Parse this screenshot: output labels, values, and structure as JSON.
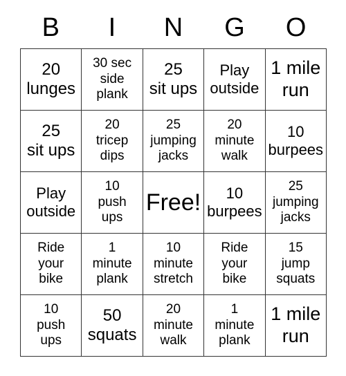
{
  "header": {
    "letters": [
      "B",
      "I",
      "N",
      "G",
      "O"
    ]
  },
  "colors": {
    "border": "#333333",
    "cell_background": "#ffffff",
    "text": "#000000",
    "page_background": "#ffffff"
  },
  "grid": {
    "rows": 5,
    "columns": 5,
    "cells": [
      {
        "text": "20\nlunges",
        "size": "fs-lg",
        "free": false
      },
      {
        "text": "30 sec\nside\nplank",
        "size": "fs-sm",
        "free": false
      },
      {
        "text": "25\nsit ups",
        "size": "fs-lg",
        "free": false
      },
      {
        "text": "Play\noutside",
        "size": "fs-md",
        "free": false
      },
      {
        "text": "1 mile\nrun",
        "size": "fs-xl",
        "free": false
      },
      {
        "text": "25\nsit ups",
        "size": "fs-lg",
        "free": false
      },
      {
        "text": "20\ntricep\ndips",
        "size": "fs-sm",
        "free": false
      },
      {
        "text": "25\njumping\njacks",
        "size": "fs-sm",
        "free": false
      },
      {
        "text": "20\nminute\nwalk",
        "size": "fs-sm",
        "free": false
      },
      {
        "text": "10\nburpees",
        "size": "fs-md",
        "free": false
      },
      {
        "text": "Play\noutside",
        "size": "fs-md",
        "free": false
      },
      {
        "text": "10\npush\nups",
        "size": "fs-sm",
        "free": false
      },
      {
        "text": "Free!",
        "size": "fs-free",
        "free": true
      },
      {
        "text": "10\nburpees",
        "size": "fs-md",
        "free": false
      },
      {
        "text": "25\njumping\njacks",
        "size": "fs-sm",
        "free": false
      },
      {
        "text": "Ride\nyour\nbike",
        "size": "fs-sm",
        "free": false
      },
      {
        "text": "1\nminute\nplank",
        "size": "fs-sm",
        "free": false
      },
      {
        "text": "10\nminute\nstretch",
        "size": "fs-sm",
        "free": false
      },
      {
        "text": "Ride\nyour\nbike",
        "size": "fs-sm",
        "free": false
      },
      {
        "text": "15\njump\nsquats",
        "size": "fs-sm",
        "free": false
      },
      {
        "text": "10\npush\nups",
        "size": "fs-sm",
        "free": false
      },
      {
        "text": "50\nsquats",
        "size": "fs-lg",
        "free": false
      },
      {
        "text": "20\nminute\nwalk",
        "size": "fs-sm",
        "free": false
      },
      {
        "text": "1\nminute\nplank",
        "size": "fs-sm",
        "free": false
      },
      {
        "text": "1 mile\nrun",
        "size": "fs-xl",
        "free": false
      }
    ]
  }
}
